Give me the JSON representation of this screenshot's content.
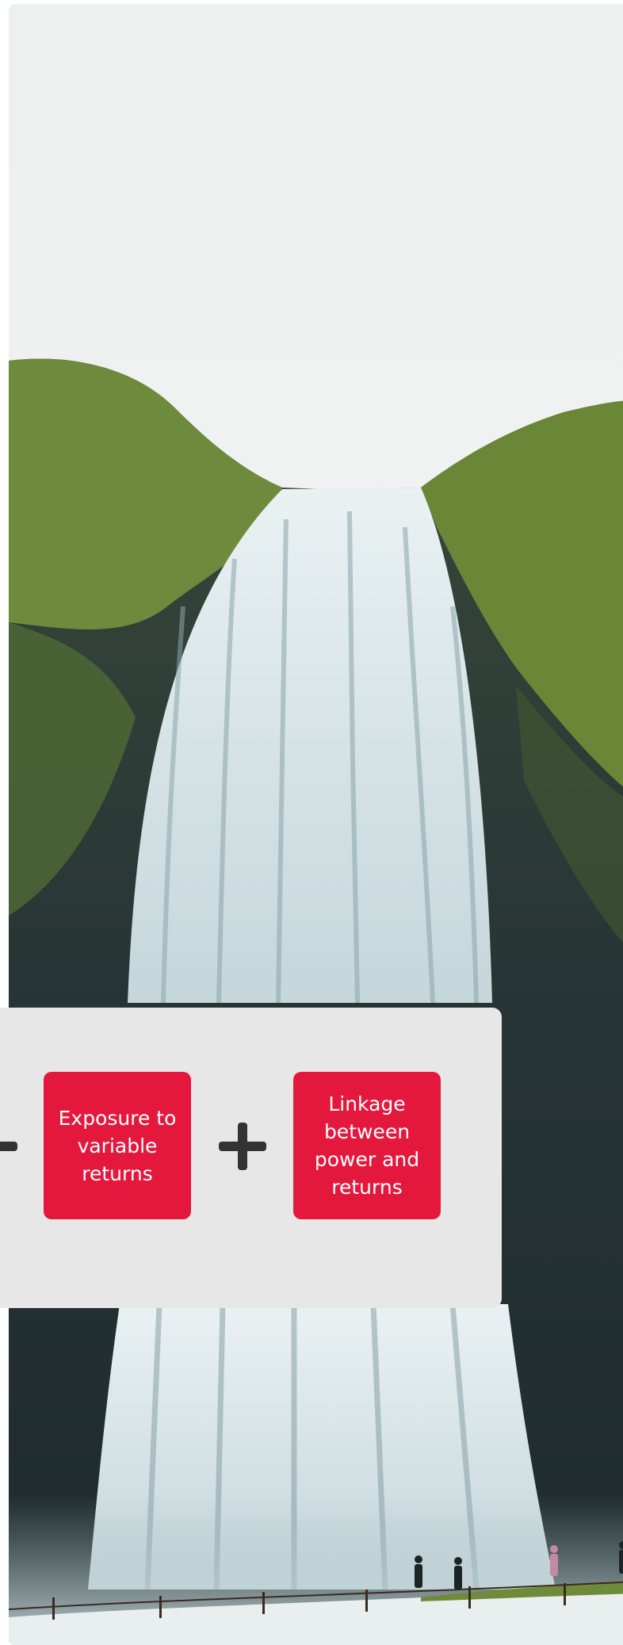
{
  "photo": {
    "subject": "waterfall-photo",
    "sky_color": "#f1f2f2",
    "moss_color": "#6f8a3a",
    "rock_color": "#2e3a3c",
    "water_color": "#dfe8ea"
  },
  "card": {
    "left_operator": "minus",
    "box_a_text": "Exposure to variable returns",
    "middle_operator": "plus",
    "box_b_text": "Linkage between power and returns",
    "box_color": "#e4183d",
    "card_color": "#e7e7e8"
  }
}
